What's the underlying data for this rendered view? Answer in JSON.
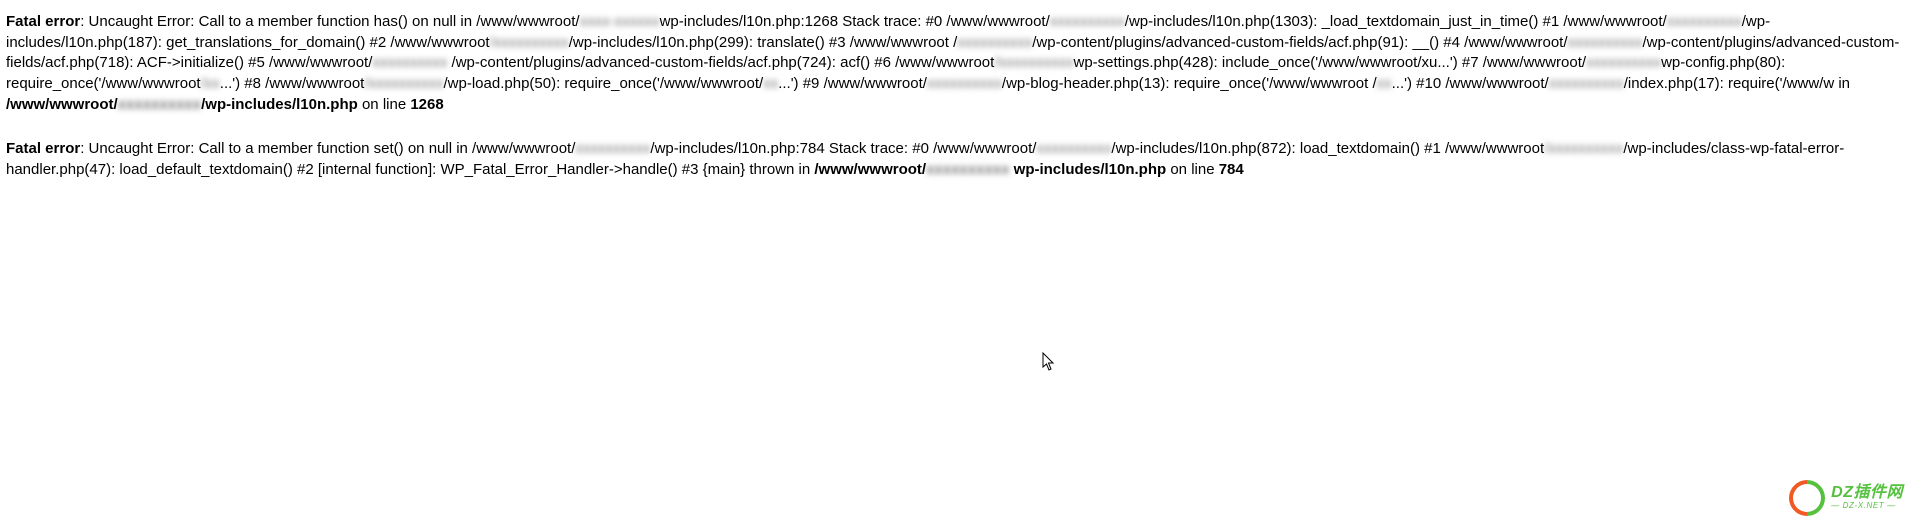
{
  "error1": {
    "label": "Fatal error",
    "sep": ": ",
    "p1a": "Uncaught Error: Call to a member function has() on null in /www/wwwroot/",
    "p1b_blur": "xxxx-xxxxxx",
    "p1c": "wp-includes/l10n.php:1268 Stack trace: #0 /www/wwwroot/",
    "p1d_blur": "xxxxxxxxxx",
    "p1e": "/wp-includes/l10n.php(1303): _load_textdomain_just_in_time() #1 /www/wwwroot/",
    "p1f_blur": "xxxxxxxxxx",
    "p1g": "/wp-includes/l10n.php(187): get_translations_for_domain() #2 /www/wwwroot",
    "p1h_blur": "/xxxxxxxxxx",
    "p1i": "/wp-includes/l10n.php(299): translate() #3 /www/wwwroot /",
    "p1j_blur": "xxxxxxxxxx",
    "p1k": "/wp-content/plugins/advanced-custom-fields/acf.php(91): __() #4 /www/wwwroot/",
    "p1l_blur": "xxxxxxxxxx",
    "p1m": "/wp-content/plugins/advanced-custom-fields/acf.php(718): ACF->initialize() #5 /www/wwwroot/",
    "p1n_blur": "xxxxxxxxxx",
    "p1o": " /wp-content/plugins/advanced-custom-fields/acf.php(724): acf() #6 /www/wwwroot",
    "p1p_blur": "/xxxxxxxxxx",
    "p1q": "wp-settings.php(428): include_once('/www/wwwroot/xu...') #7 /www/wwwroot/",
    "p1r_blur": "xxxxxxxxxx",
    "p1s": "wp-config.php(80): require_once('/www/wwwroot",
    "p1t_blur": "/xx",
    "p1u": "...') #8 /www/wwwroot",
    "p1v_blur": "/xxxxxxxxxx",
    "p1w": "/wp-load.php(50): require_once('/www/wwwroot/",
    "p1x_blur": "xx",
    "p1y": "...') #9 /www/wwwroot/",
    "p1z_blur": "xxxxxxxxxx",
    "p1aa": "/wp-blog-header.php(13): require_once('/www/wwwroot /",
    "p1ab_blur": "xx",
    "p1ac": "...') #10 /www/wwwroot/",
    "p1ad_blur": "xxxxxxxxxx",
    "p1ae": "/index.php(17): require('/www/w in ",
    "bold_path_a": "/www/wwwroot/",
    "bold_path_blur": "xxxxxxxxxx",
    "bold_path_b": "/wp-includes/l10n.php",
    "on_line": " on line ",
    "line_no": "1268"
  },
  "error2": {
    "label": "Fatal error",
    "sep": ": ",
    "p2a": "Uncaught Error: Call to a member function set() on null in /www/wwwroot/",
    "p2b_blur": "xxxxxxxxxx",
    "p2c": "/wp-includes/l10n.php:784 Stack trace: #0 /www/wwwroot/",
    "p2d_blur": "xxxxxxxxxx",
    "p2e": "/wp-includes/l10n.php(872): load_textdomain() #1 /www/wwwroot",
    "p2f_blur": "/xxxxxxxxxx",
    "p2g": "/wp-includes/class-wp-fatal-error-handler.php(47): load_default_textdomain() #2 [internal function]: WP_Fatal_Error_Handler->handle() #3 {main} thrown in ",
    "bold_path_a": "/www/wwwroot/",
    "bold_path_blur": "xxxxxxxxxx ",
    "bold_path_b": "wp-includes/l10n.php",
    "on_line": " on line ",
    "line_no": "784"
  },
  "watermark": {
    "main": "DZ插件网",
    "sub": "— DZ-X.NET —"
  }
}
